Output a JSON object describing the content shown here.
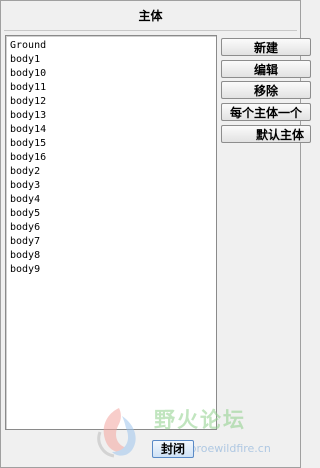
{
  "window": {
    "title": "主体"
  },
  "body_list": {
    "items": [
      "Ground",
      "body1",
      "body10",
      "body11",
      "body12",
      "body13",
      "body14",
      "body15",
      "body16",
      "body2",
      "body3",
      "body4",
      "body5",
      "body6",
      "body7",
      "body8",
      "body9"
    ]
  },
  "buttons": {
    "new_label": "新建",
    "edit_label": "编辑",
    "remove_label": "移除",
    "each_body_label": "每个主体一个",
    "default_body_label": "默认主体",
    "close_label": "封闭"
  },
  "watermark": {
    "text_cn": "野火论坛",
    "url": "www.proewildfire.cn"
  },
  "colors": {
    "accent": "#5a8ac6",
    "watermark_green": "#8fd18b"
  }
}
